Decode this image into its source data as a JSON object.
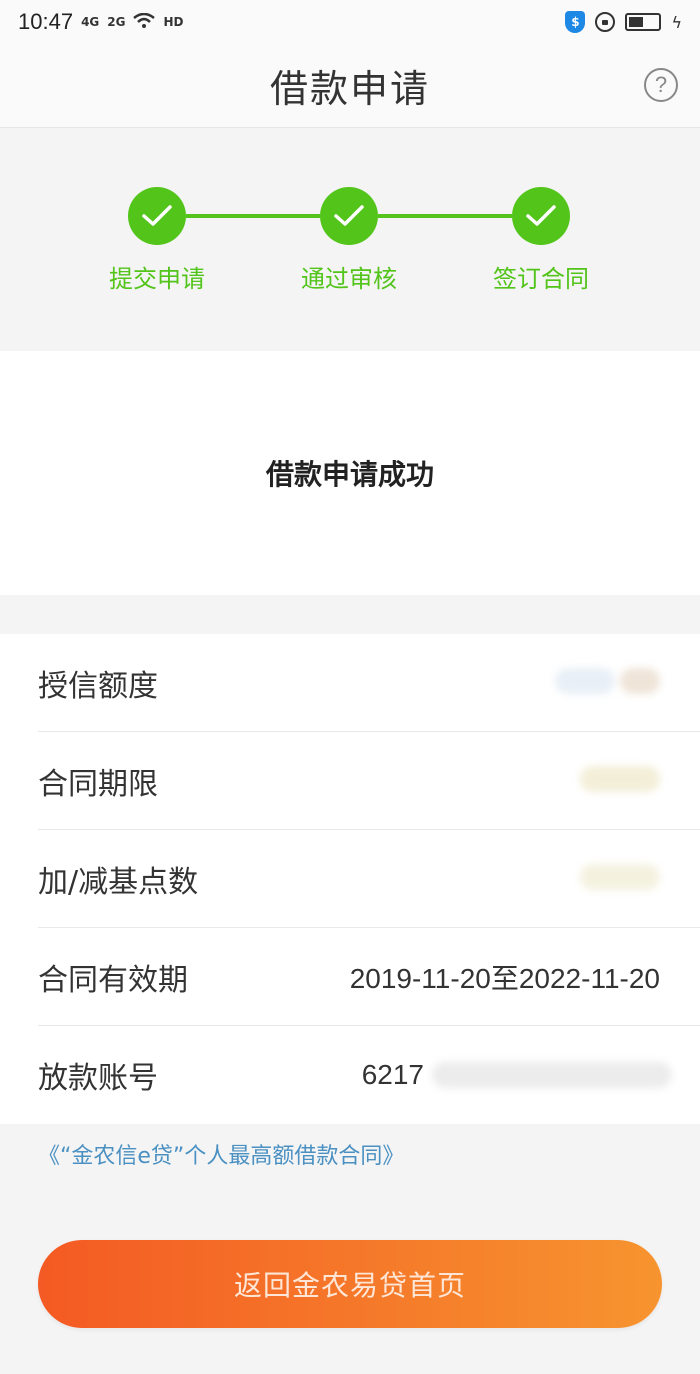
{
  "status_bar": {
    "time": "10:47",
    "net1": "4G",
    "net2": "2G",
    "hd": "HD",
    "battery_level": 0.5
  },
  "header": {
    "title": "借款申请",
    "help_icon": "question-circle-icon"
  },
  "steps": [
    {
      "label": "提交申请",
      "done": true
    },
    {
      "label": "通过审核",
      "done": true
    },
    {
      "label": "签订合同",
      "done": true
    }
  ],
  "success_message": "借款申请成功",
  "info": {
    "credit_label": "授信额度",
    "term_label": "合同期限",
    "points_label": "加/减基点数",
    "validity_label": "合同有效期",
    "validity_value": "2019-11-20至2022-11-20",
    "account_label": "放款账号",
    "account_value": "6217"
  },
  "contract_link": "《“金农信e贷”个人最高额借款合同》",
  "home_button": "返回金农易贷首页",
  "colors": {
    "step_green": "#52c41a",
    "link_blue": "#4a90c2",
    "button_orange": "#f45a23"
  }
}
